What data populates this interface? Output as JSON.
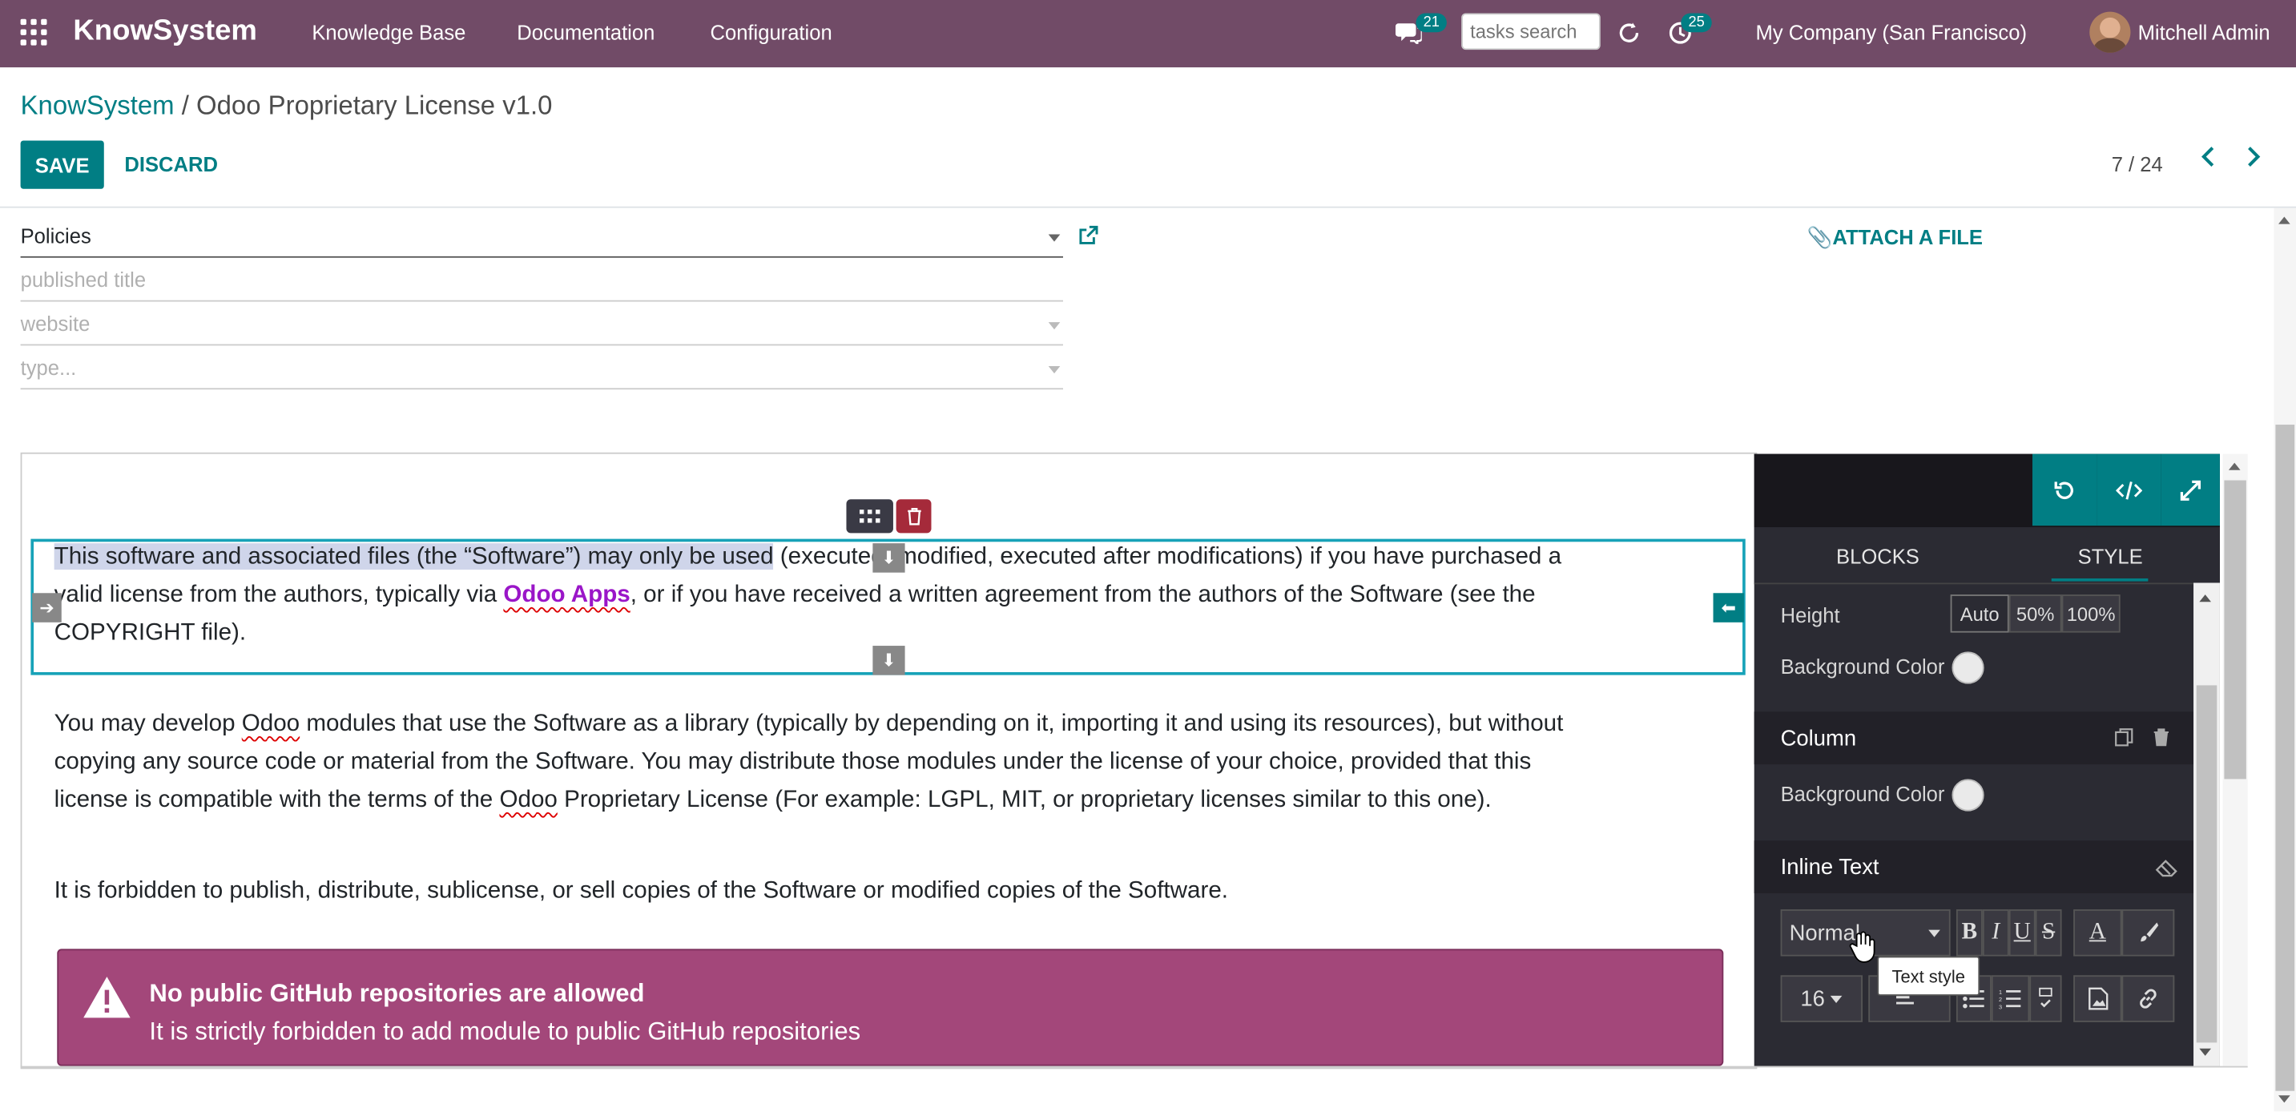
{
  "navbar": {
    "app_name": "KnowSystem",
    "menu": [
      "Knowledge Base",
      "Documentation",
      "Configuration"
    ],
    "messages_count": "21",
    "search_placeholder": "tasks search",
    "activities_count": "25",
    "company": "My Company (San Francisco)",
    "user": "Mitchell Admin"
  },
  "breadcrumb": {
    "parent": "KnowSystem",
    "separator": " / ",
    "current": "Odoo Proprietary License v1.0"
  },
  "actions": {
    "save_label": "SAVE",
    "discard_label": "DISCARD"
  },
  "pager": {
    "value": "7 / 24"
  },
  "form": {
    "section_value": "Policies",
    "published_title_placeholder": "published title",
    "website_placeholder": "website",
    "type_placeholder": "type...",
    "attach_label": "ATTACH A FILE"
  },
  "editor": {
    "para1_highlight": "This software and associated files (the “Software”) may only be used",
    "para1_rest_a": " (executed, modified, executed after modifications) if you have purchased a",
    "para1_line2_a": "valid license from the authors, typically via ",
    "para1_link": "Odoo Apps",
    "para1_line2_b": ", or if you have received a written agreement from the authors of the Software (see the",
    "para1_line3": "COPYRIGHT file).",
    "para2_line1_a": "You may develop ",
    "para2_odoo": "Odoo",
    "para2_line1_b": " modules that use the Software as a library (typically by depending on it, importing it and using its resources), but without",
    "para2_line2": "copying any source code or material from the Software. You may distribute those modules under the license of your choice, provided that this",
    "para2_line3_a": "license is compatible with the terms of the ",
    "para2_odoo2": "Odoo",
    "para2_line3_b": " Proprietary License (For example: LGPL, MIT, or proprietary licenses similar to this one).",
    "para3": "It is forbidden to publish, distribute, sublicense, or sell copies of the Software or modified copies of the Software.",
    "alert_title": "No public GitHub repositories are allowed",
    "alert_body": "It is strictly forbidden to add module to public GitHub repositories"
  },
  "sidebar": {
    "tab_blocks": "BLOCKS",
    "tab_style": "STYLE",
    "height_label": "Height",
    "height_options": [
      "Auto",
      "50%",
      "100%"
    ],
    "bg_color_label": "Background Color",
    "column_title": "Column",
    "column_bg_label": "Background Color",
    "inline_text_title": "Inline Text",
    "text_style_value": "Normal",
    "font_size_value": "16",
    "tooltip": "Text style",
    "bold": "B",
    "italic": "I",
    "underline": "U",
    "strike": "S",
    "font_color": "A"
  },
  "colors": {
    "navbar": "#714B67",
    "primary": "#017e84",
    "alert": "#a3477a",
    "link": "#9a16c8",
    "selection": "#17a2b8"
  }
}
